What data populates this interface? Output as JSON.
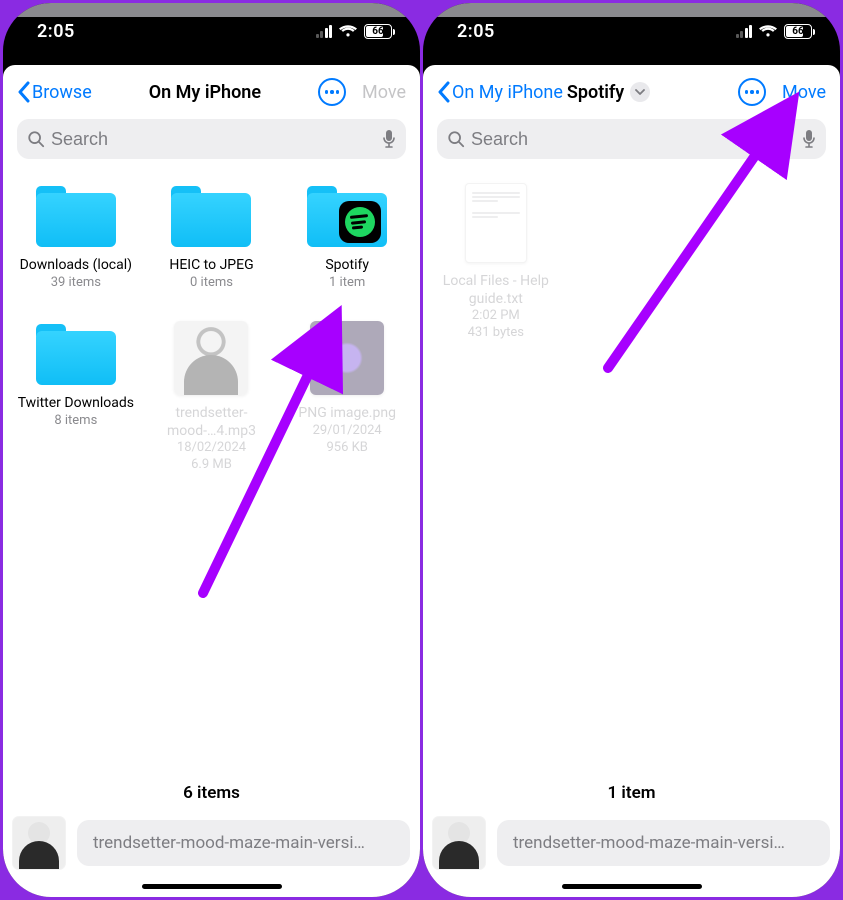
{
  "status": {
    "time": "2:05",
    "battery": "66"
  },
  "left": {
    "back_label": "Browse",
    "title": "On My iPhone",
    "move_label": "Move",
    "move_enabled": false,
    "search_placeholder": "Search",
    "items": [
      {
        "name": "Downloads (local)",
        "meta": "39 items",
        "kind": "folder"
      },
      {
        "name": "HEIC to JPEG",
        "meta": "0 items",
        "kind": "folder"
      },
      {
        "name": "Spotify",
        "meta": "1 item",
        "kind": "folder-spotify"
      },
      {
        "name": "Twitter Downloads",
        "meta": "8 items",
        "kind": "folder"
      },
      {
        "name": "trendsetter-mood-…4.mp3",
        "date": "18/02/2024",
        "size": "6.9 MB",
        "kind": "file-person",
        "dim": true
      },
      {
        "name": "PNG image.png",
        "date": "29/01/2024",
        "size": "956 KB",
        "kind": "file-dark",
        "dim": true
      }
    ],
    "footer": "6 items",
    "clipboard": "trendsetter-mood-maze-main-versi…"
  },
  "right": {
    "back_label": "On My iPhone",
    "title": "Spotify",
    "move_label": "Move",
    "move_enabled": true,
    "search_placeholder": "Search",
    "items": [
      {
        "name": "Local Files - Help guide.txt",
        "date": "2:02 PM",
        "size": "431 bytes",
        "kind": "file-doc",
        "dim": true
      }
    ],
    "footer": "1 item",
    "clipboard": "trendsetter-mood-maze-main-versi…"
  }
}
